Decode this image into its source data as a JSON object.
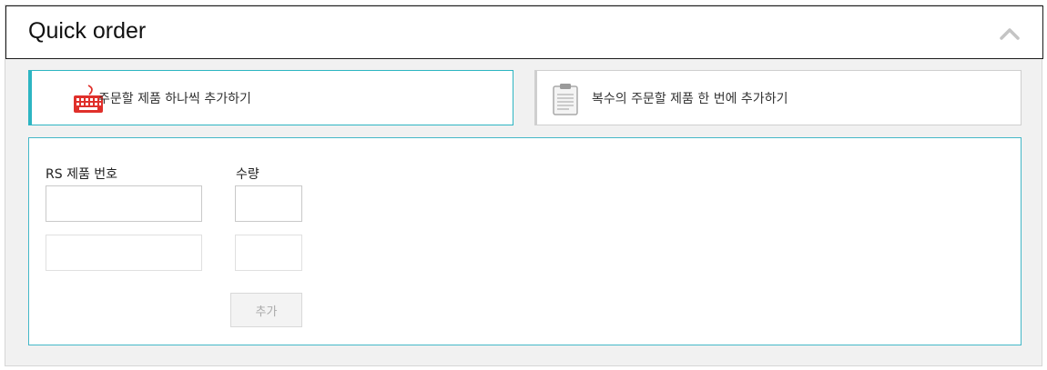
{
  "header": {
    "title": "Quick order",
    "collapse_icon": "chevron-up-icon"
  },
  "tabs": [
    {
      "label": "주문할 제품 하나씩 추가하기",
      "icon": "keyboard-icon",
      "active": true
    },
    {
      "label": "복수의 주문할 제품 한 번에 추가하기",
      "icon": "clipboard-icon",
      "active": false
    }
  ],
  "form": {
    "part_number_label": "RS 제품 번호",
    "quantity_label": "수량",
    "rows": [
      {
        "part_number": "",
        "quantity": ""
      },
      {
        "part_number": "",
        "quantity": ""
      }
    ],
    "add_button_label": "추가"
  },
  "colors": {
    "accent": "#2db5c2",
    "keyboard_icon": "#e0302b"
  }
}
